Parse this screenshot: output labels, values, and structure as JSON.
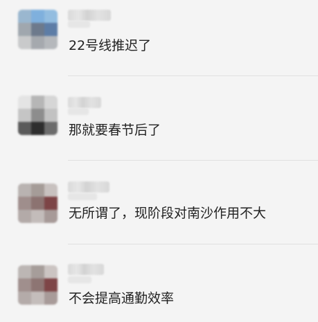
{
  "comments": [
    {
      "text": "22号线推迟了",
      "avatar_colors": [
        "#9ab7cf",
        "#7fb0dd",
        "#93bde0",
        "#a0a7ae",
        "#6d7a8c",
        "#5d7da6",
        "#c9cacb",
        "#a5a9ae",
        "#b5b8bc"
      ]
    },
    {
      "text": "那就要春节后了",
      "avatar_colors": [
        "#e4e4e4",
        "#b6b6b6",
        "#d6d6d6",
        "#c5c5c5",
        "#8d8d8d",
        "#c2c2c2",
        "#5a5a5a",
        "#2e2e2e",
        "#6c6c6c"
      ]
    },
    {
      "text": "无所谓了，现阶段对南沙作用不大",
      "avatar_colors": [
        "#b9b3b1",
        "#a59c98",
        "#c8c1bf",
        "#9f8e8c",
        "#8c7371",
        "#7d4446",
        "#b3aaa8",
        "#c3bcba",
        "#a79a98"
      ]
    },
    {
      "text": "不会提高通勤效率",
      "avatar_colors": [
        "#bcb6b4",
        "#a69d9a",
        "#cbc4c2",
        "#a08f8d",
        "#8d7573",
        "#7e4547",
        "#b4aba9",
        "#c4bdbb",
        "#a89b99"
      ]
    }
  ]
}
